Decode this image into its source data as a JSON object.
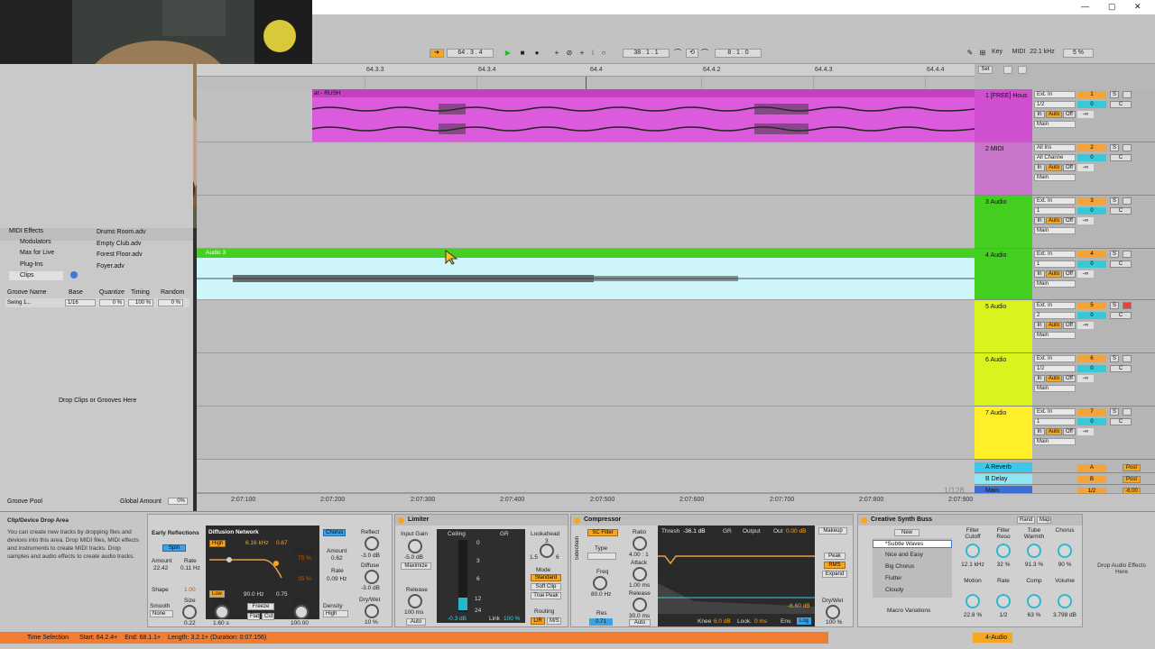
{
  "window": {
    "controls": [
      "—",
      "▢",
      "✕"
    ]
  },
  "transport": {
    "follow_icon": "follow-arrow",
    "position": "64 . 3 . 4",
    "loop_start": "38 . 1 . 1",
    "loop_length": "8 . 1 . 0",
    "key_label": "Key",
    "midi_label": "MIDI",
    "sample_rate": "22.1 kHz",
    "cpu": "5 %"
  },
  "ruler": {
    "labels": [
      "64.3.3",
      "64.3.4",
      "64.4",
      "64.4.2",
      "64.4.3",
      "64.4.4"
    ],
    "set_label": "Set"
  },
  "time_ruler": {
    "labels": [
      "2:07:100",
      "2:07:200",
      "2:07:300",
      "2:07:400",
      "2:07:500",
      "2:07:600",
      "2:07:700",
      "2:07:800",
      "2:07:900"
    ],
    "zoom": "1/128"
  },
  "browser": {
    "categories": [
      "MIDI Effects",
      "Modulators",
      "Max for Live",
      "Plug-Ins",
      "Clips"
    ],
    "files": [
      "Drums Room.adv",
      "Empty Club.adv",
      "Forest Floor.adv",
      "Foyer.adv"
    ],
    "groove_headers": [
      "Groove Name",
      "Base",
      "Quantize",
      "Timing",
      "Random"
    ],
    "groove_row": {
      "name": "Swing 1...",
      "base": "1/16",
      "quantize": "0 %",
      "timing": "100 %",
      "random": "0 %"
    },
    "drop_text": "Drop Clips or Grooves Here",
    "groove_pool": "Groove Pool",
    "global_amount_label": "Global Amount",
    "global_amount": "0%"
  },
  "clips": {
    "clip1_name": "at - RUSH",
    "clip4_name": "Audio 3"
  },
  "tracks": [
    {
      "name": "1 [FREE] Hous",
      "input": "Ext. In",
      "channel": "1/2",
      "number": "1",
      "color": "#d04fd0",
      "volume": "0"
    },
    {
      "name": "2 MIDI",
      "input": "All Ins",
      "channel": "All Channe",
      "number": "2",
      "color": "#c874c8",
      "volume": "0"
    },
    {
      "name": "3 Audio",
      "input": "Ext. In",
      "channel": "1",
      "number": "3",
      "color": "#43cf1f",
      "volume": "0"
    },
    {
      "name": "4 Audio",
      "input": "Ext. In",
      "channel": "1",
      "number": "4",
      "color": "#43cf1f",
      "volume": "0"
    },
    {
      "name": "5 Audio",
      "input": "Ext. In",
      "channel": "2",
      "number": "5",
      "color": "#d9f41c",
      "volume": "0"
    },
    {
      "name": "6 Audio",
      "input": "Ext. In",
      "channel": "1/2",
      "number": "6",
      "color": "#d9f41c",
      "volume": "0"
    },
    {
      "name": "7 Audio",
      "input": "Ext. In",
      "channel": "1",
      "number": "7",
      "color": "#ffef2a",
      "volume": "0"
    }
  ],
  "track_labels": {
    "in": "In",
    "auto": "Auto",
    "off": "Off",
    "main": "Main",
    "solo": "S",
    "c": "C",
    "inf": "-∞"
  },
  "returns": [
    {
      "name": "A Reverb",
      "letter": "A",
      "color": "#3cc8e8"
    },
    {
      "name": "B Delay",
      "letter": "B",
      "color": "#8fe6f2"
    },
    {
      "name": "Main",
      "letter": "1/2",
      "color": "#3c6fd6"
    }
  ],
  "return_labels": {
    "post": "Post",
    "main_volume": "0",
    "main_vol2": "-6.00"
  },
  "devices": {
    "drop_title": "Clip/Device Drop Area",
    "drop_text": "You can create new tracks by dropping files and devices into this area. Drop MIDI files, MIDI effects and instruments to create MIDI tracks. Drop samples and audio effects to create audio tracks.",
    "reverb": {
      "early_reflections": "Early Reflections",
      "diffusion_network": "Diffusion Network",
      "chorus": "Chorus",
      "spin": "Spin",
      "amount_label": "Amount",
      "amount": "22.42",
      "rate_label": "Rate",
      "rate": "0.11 Hz",
      "high_label": "High",
      "high_freq": "6.16 kHz",
      "high_val": "0.67",
      "low_label": "Low",
      "low_freq": "90.0 Hz",
      "low_val": "0.75",
      "shape_label": "Shape",
      "shape": "1.00",
      "diffusion_label": "Diffusion",
      "diffusion": "75 %",
      "scale_label": "Scale",
      "scale": "35 %",
      "chorus_amount_label": "Amount",
      "chorus_amount": "0.62",
      "chorus_rate_label": "Rate",
      "chorus_rate": "0.09 Hz",
      "reflect_label": "Reflect",
      "reflect": "-3.0 dB",
      "diffuse_label": "Diffuse",
      "diffuse": "-3.0 dB",
      "drywet_label": "Dry/Wet",
      "drywet": "10 %",
      "smooth_label": "Smooth",
      "smooth": "None",
      "size_label": "Size",
      "size": "0.22",
      "decay_label": "Decay",
      "decay": "1.60 s",
      "freeze": "Freeze",
      "flat": "Flat",
      "cut": "Cut",
      "stereo_label": "Stereo",
      "stereo": "100.00",
      "density_label": "Density",
      "density": "High"
    },
    "limiter": {
      "title": "Limiter",
      "input_gain_label": "Input Gain",
      "input_gain": "-5.0 dB",
      "maximize": "Maximize",
      "ceiling_label": "Ceiling",
      "ceiling": "-0.3 dB",
      "gr_label": "GR",
      "gr_ticks": [
        "0",
        "3",
        "6",
        "12",
        "24"
      ],
      "release_label": "Release",
      "release": "100 ms",
      "auto": "Auto",
      "link_label": "Link",
      "link": "100 %",
      "lookahead_label": "Lookahead",
      "lookahead_ticks": [
        "1.5",
        "3",
        "6"
      ],
      "mode_label": "Mode",
      "modes": [
        "Standard",
        "Soft Clip",
        "True Peak"
      ],
      "routing_label": "Routing",
      "routing": [
        "L/R",
        "M/S"
      ]
    },
    "compressor": {
      "title": "Compressor",
      "sidechain": "Sidechain",
      "sc_filter": "SC Filter",
      "type_label": "Type",
      "freq_label": "Freq",
      "freq": "80.0 Hz",
      "res_label": "Res",
      "res": "0.71",
      "ratio_label": "Ratio",
      "ratio": "4.00 : 1",
      "attack_label": "Attack",
      "attack": "1.00 ms",
      "release_label": "Release",
      "release": "30.0 ms",
      "auto": "Auto",
      "thresh_label": "Thresh",
      "thresh": "-36.1 dB",
      "gr_label": "GR",
      "output_label": "Output",
      "out_label": "Out",
      "out": "0.00 dB",
      "gr_readout": "-6.60 dB",
      "knee_label": "Knee",
      "knee": "6.0 dB",
      "look_label": "Look.",
      "look": "0 ms",
      "env_label": "Env.",
      "env": "Log",
      "makeup": "Makeup",
      "peak": "Peak",
      "rms": "RMS",
      "expand": "Expand",
      "drywet_label": "Dry/Wet",
      "drywet": "100 %"
    },
    "synth_buss": {
      "title": "Creative Synth Buss",
      "rand": "Rand",
      "map": "Map",
      "new": "New",
      "presets": [
        "*Subtle Waves",
        "Nice and Easy",
        "Big Chorus",
        "Flutter",
        "Cloudy"
      ],
      "macro_variations": "Macro Variations",
      "macros": [
        {
          "label": "Filter Cutoff",
          "value": "12.1 kHz"
        },
        {
          "label": "Filter Reso",
          "value": "32 %"
        },
        {
          "label": "Tube Warmth",
          "value": "91.3 %"
        },
        {
          "label": "Chorus",
          "value": "90 %"
        },
        {
          "label": "Motion",
          "value": "22.8 %"
        },
        {
          "label": "Rate",
          "value": "1/2"
        },
        {
          "label": "Comp",
          "value": "63 %"
        },
        {
          "label": "Volume",
          "value": "3.798 dB"
        }
      ]
    },
    "drop_effects": "Drop Audio Effects Here"
  },
  "status": {
    "time_selection": "Time Selection",
    "start": "Start: 64.2.4+",
    "end": "End: 68.1.1+",
    "length": "Length: 3.2.1+ (Duration: 0:07:156)",
    "track": "4-Audio"
  }
}
